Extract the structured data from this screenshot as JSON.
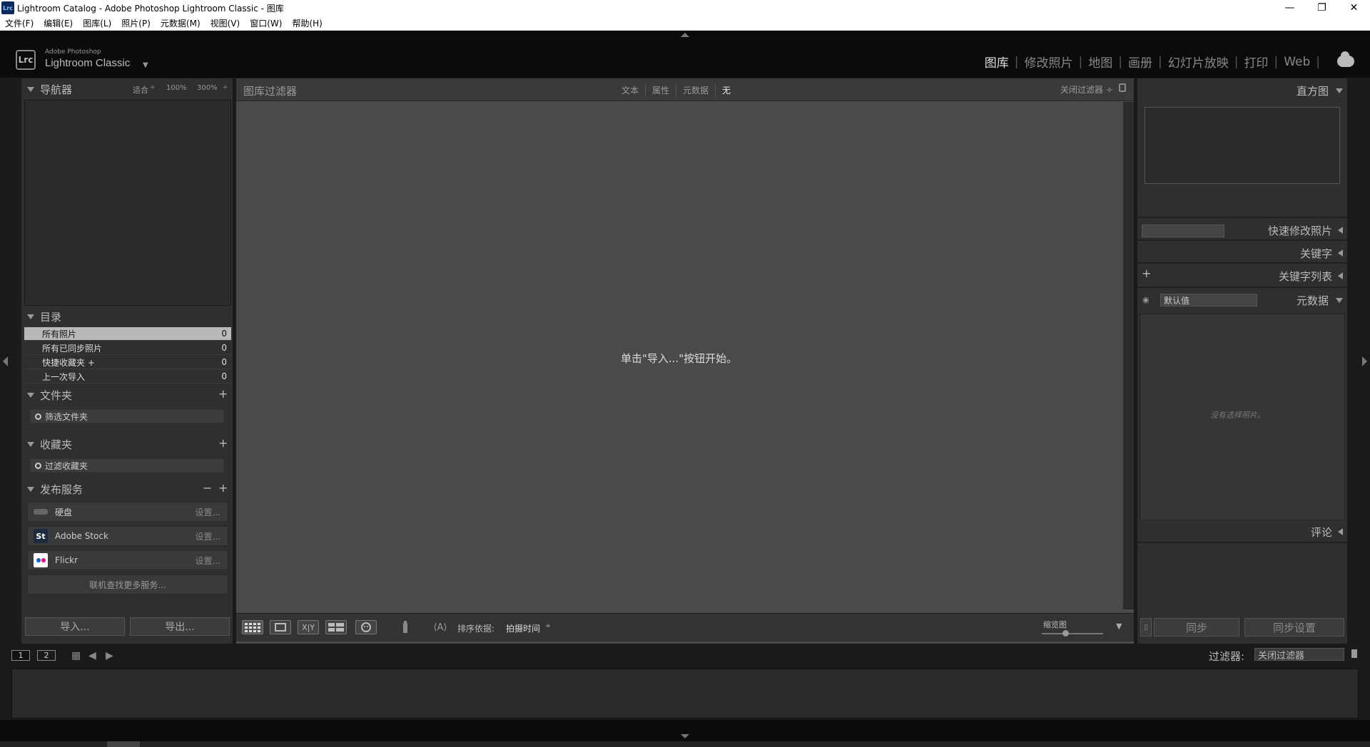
{
  "window": {
    "title": "Lightroom Catalog - Adobe Photoshop Lightroom Classic - 图库",
    "icon_text": "Lrc"
  },
  "menu": [
    "文件(F)",
    "编辑(E)",
    "图库(L)",
    "照片(P)",
    "元数据(M)",
    "视图(V)",
    "窗口(W)",
    "帮助(H)"
  ],
  "brand": {
    "logo": "Lrc",
    "line1": "Adobe Photoshop",
    "line2": "Lightroom Classic"
  },
  "modules": [
    "图库",
    "修改照片",
    "地图",
    "画册",
    "幻灯片放映",
    "打印",
    "Web"
  ],
  "active_module": "图库",
  "navigator": {
    "title": "导航器",
    "zoom_fit": "适合",
    "zoom_100": "100%",
    "zoom_300": "300%"
  },
  "catalog": {
    "title": "目录",
    "items": [
      {
        "label": "所有照片",
        "count": "0"
      },
      {
        "label": "所有已同步照片",
        "count": "0"
      },
      {
        "label": "快捷收藏夹 +",
        "count": "0"
      },
      {
        "label": "上一次导入",
        "count": "0"
      }
    ]
  },
  "folders": {
    "title": "文件夹",
    "search_placeholder": "筛选文件夹"
  },
  "collections": {
    "title": "收藏夹",
    "search_placeholder": "过滤收藏夹"
  },
  "publish": {
    "title": "发布服务",
    "services": [
      {
        "name": "硬盘",
        "setting": "设置..."
      },
      {
        "name": "Adobe Stock",
        "setting": "设置...",
        "icon": "St"
      },
      {
        "name": "Flickr",
        "setting": "设置..."
      }
    ],
    "find_more": "联机查找更多服务..."
  },
  "left_buttons": {
    "import": "导入...",
    "export": "导出..."
  },
  "library_filter": {
    "title": "图库过滤器",
    "options": [
      "文本",
      "属性",
      "元数据",
      "无"
    ],
    "selected": "无",
    "close": "关闭过滤器 ÷"
  },
  "grid": {
    "empty_message": "单击\"导入...\"按钮开始。"
  },
  "toolbar": {
    "sort_label": "排序依据:",
    "sort_value": "拍摄时间",
    "thumb_label": "缩览图"
  },
  "right_panel": {
    "histogram": "直方图",
    "quick_develop": "快速修改照片",
    "keywording": "关键字",
    "keyword_list": "关键字列表",
    "metadata": "元数据",
    "metadata_preset": "默认值",
    "no_photo": "没有选择照片。",
    "comments": "评论",
    "sync": "同步",
    "sync_settings": "同步设置"
  },
  "filmstrip": {
    "page1": "1",
    "page2": "2",
    "filter_label": "过滤器:",
    "filter_value": "关闭过滤器"
  }
}
